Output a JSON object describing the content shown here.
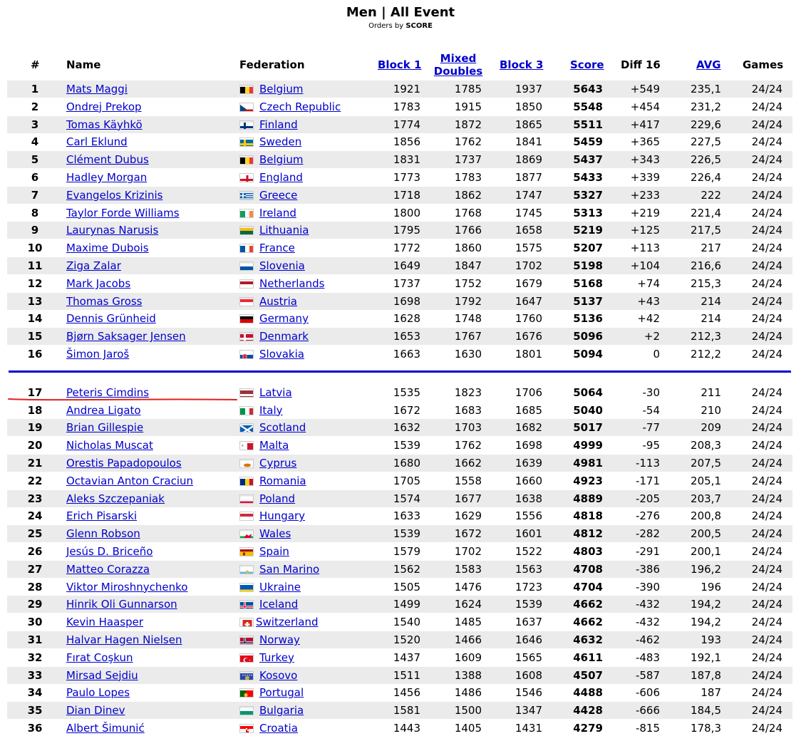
{
  "header": {
    "title": "Men | All Event",
    "subtitle_prefix": "Orders by",
    "subtitle_key": "SCORE"
  },
  "columns": {
    "rank": "#",
    "name": "Name",
    "federation": "Federation",
    "block1": "Block 1",
    "mixed1": "Mixed",
    "mixed2": "Doubles",
    "block3": "Block 3",
    "score": "Score",
    "diff": "Diff 16",
    "avg": "AVG",
    "games": "Games"
  },
  "colors": {
    "link": "#0000cc",
    "separator": "#0000cc",
    "highlight_underline": "#e0201e",
    "row_alt": "#ebebeb"
  },
  "rows": [
    {
      "rank": "1",
      "name": "Mats Maggi",
      "federation": "Belgium",
      "flag": "be",
      "block1": "1921",
      "mixed": "1785",
      "block3": "1937",
      "score": "5643",
      "diff": "+549",
      "avg": "235,1",
      "games": "24/24"
    },
    {
      "rank": "2",
      "name": "Ondrej Prekop",
      "federation": "Czech Republic",
      "flag": "cz",
      "block1": "1783",
      "mixed": "1915",
      "block3": "1850",
      "score": "5548",
      "diff": "+454",
      "avg": "231,2",
      "games": "24/24"
    },
    {
      "rank": "3",
      "name": "Tomas Käyhkö",
      "federation": "Finland",
      "flag": "fi",
      "block1": "1774",
      "mixed": "1872",
      "block3": "1865",
      "score": "5511",
      "diff": "+417",
      "avg": "229,6",
      "games": "24/24"
    },
    {
      "rank": "4",
      "name": "Carl Eklund",
      "federation": "Sweden",
      "flag": "se",
      "block1": "1856",
      "mixed": "1762",
      "block3": "1841",
      "score": "5459",
      "diff": "+365",
      "avg": "227,5",
      "games": "24/24"
    },
    {
      "rank": "5",
      "name": "Clément Dubus",
      "federation": "Belgium",
      "flag": "be",
      "block1": "1831",
      "mixed": "1737",
      "block3": "1869",
      "score": "5437",
      "diff": "+343",
      "avg": "226,5",
      "games": "24/24"
    },
    {
      "rank": "6",
      "name": "Hadley Morgan",
      "federation": "England",
      "flag": "en",
      "block1": "1773",
      "mixed": "1783",
      "block3": "1877",
      "score": "5433",
      "diff": "+339",
      "avg": "226,4",
      "games": "24/24"
    },
    {
      "rank": "7",
      "name": "Evangelos Krizinis",
      "federation": "Greece",
      "flag": "gr",
      "block1": "1718",
      "mixed": "1862",
      "block3": "1747",
      "score": "5327",
      "diff": "+233",
      "avg": "222",
      "games": "24/24"
    },
    {
      "rank": "8",
      "name": "Taylor Forde Williams",
      "federation": "Ireland",
      "flag": "ie",
      "block1": "1800",
      "mixed": "1768",
      "block3": "1745",
      "score": "5313",
      "diff": "+219",
      "avg": "221,4",
      "games": "24/24"
    },
    {
      "rank": "9",
      "name": "Laurynas Narusis",
      "federation": "Lithuania",
      "flag": "lt",
      "block1": "1795",
      "mixed": "1766",
      "block3": "1658",
      "score": "5219",
      "diff": "+125",
      "avg": "217,5",
      "games": "24/24"
    },
    {
      "rank": "10",
      "name": "Maxime Dubois",
      "federation": "France",
      "flag": "fr",
      "block1": "1772",
      "mixed": "1860",
      "block3": "1575",
      "score": "5207",
      "diff": "+113",
      "avg": "217",
      "games": "24/24"
    },
    {
      "rank": "11",
      "name": "Ziga Zalar",
      "federation": "Slovenia",
      "flag": "si",
      "block1": "1649",
      "mixed": "1847",
      "block3": "1702",
      "score": "5198",
      "diff": "+104",
      "avg": "216,6",
      "games": "24/24"
    },
    {
      "rank": "12",
      "name": "Mark Jacobs",
      "federation": "Netherlands",
      "flag": "nl",
      "block1": "1737",
      "mixed": "1752",
      "block3": "1679",
      "score": "5168",
      "diff": "+74",
      "avg": "215,3",
      "games": "24/24"
    },
    {
      "rank": "13",
      "name": "Thomas Gross",
      "federation": "Austria",
      "flag": "at",
      "block1": "1698",
      "mixed": "1792",
      "block3": "1647",
      "score": "5137",
      "diff": "+43",
      "avg": "214",
      "games": "24/24"
    },
    {
      "rank": "14",
      "name": "Dennis Grünheid",
      "federation": "Germany",
      "flag": "de",
      "block1": "1628",
      "mixed": "1748",
      "block3": "1760",
      "score": "5136",
      "diff": "+42",
      "avg": "214",
      "games": "24/24"
    },
    {
      "rank": "15",
      "name": "Bjørn Saksager Jensen",
      "federation": "Denmark",
      "flag": "dk",
      "block1": "1653",
      "mixed": "1767",
      "block3": "1676",
      "score": "5096",
      "diff": "+2",
      "avg": "212,3",
      "games": "24/24"
    },
    {
      "rank": "16",
      "name": "Šimon Jaroš",
      "federation": "Slovakia",
      "flag": "sk",
      "block1": "1663",
      "mixed": "1630",
      "block3": "1801",
      "score": "5094",
      "diff": "0",
      "avg": "212,2",
      "games": "24/24"
    },
    {
      "rank": "17",
      "name": "Peteris Cimdins",
      "federation": "Latvia",
      "flag": "lv",
      "block1": "1535",
      "mixed": "1823",
      "block3": "1706",
      "score": "5064",
      "diff": "-30",
      "avg": "211",
      "games": "24/24"
    },
    {
      "rank": "18",
      "name": "Andrea Ligato",
      "federation": "Italy",
      "flag": "it",
      "block1": "1672",
      "mixed": "1683",
      "block3": "1685",
      "score": "5040",
      "diff": "-54",
      "avg": "210",
      "games": "24/24"
    },
    {
      "rank": "19",
      "name": "Brian Gillespie",
      "federation": "Scotland",
      "flag": "sc",
      "block1": "1632",
      "mixed": "1703",
      "block3": "1682",
      "score": "5017",
      "diff": "-77",
      "avg": "209",
      "games": "24/24"
    },
    {
      "rank": "20",
      "name": "Nicholas Muscat",
      "federation": "Malta",
      "flag": "mt",
      "block1": "1539",
      "mixed": "1762",
      "block3": "1698",
      "score": "4999",
      "diff": "-95",
      "avg": "208,3",
      "games": "24/24"
    },
    {
      "rank": "21",
      "name": "Orestis Papadopoulos",
      "federation": "Cyprus",
      "flag": "cy",
      "block1": "1680",
      "mixed": "1662",
      "block3": "1639",
      "score": "4981",
      "diff": "-113",
      "avg": "207,5",
      "games": "24/24"
    },
    {
      "rank": "22",
      "name": "Octavian Anton Craciun",
      "federation": "Romania",
      "flag": "ro",
      "block1": "1705",
      "mixed": "1558",
      "block3": "1660",
      "score": "4923",
      "diff": "-171",
      "avg": "205,1",
      "games": "24/24"
    },
    {
      "rank": "23",
      "name": "Aleks Szczepaniak",
      "federation": "Poland",
      "flag": "pl",
      "block1": "1574",
      "mixed": "1677",
      "block3": "1638",
      "score": "4889",
      "diff": "-205",
      "avg": "203,7",
      "games": "24/24"
    },
    {
      "rank": "24",
      "name": "Erich Pisarski",
      "federation": "Hungary",
      "flag": "hu",
      "block1": "1633",
      "mixed": "1629",
      "block3": "1556",
      "score": "4818",
      "diff": "-276",
      "avg": "200,8",
      "games": "24/24"
    },
    {
      "rank": "25",
      "name": "Glenn Robson",
      "federation": "Wales",
      "flag": "wa",
      "block1": "1539",
      "mixed": "1672",
      "block3": "1601",
      "score": "4812",
      "diff": "-282",
      "avg": "200,5",
      "games": "24/24"
    },
    {
      "rank": "26",
      "name": "Jesús D. Briceño",
      "federation": "Spain",
      "flag": "es",
      "block1": "1579",
      "mixed": "1702",
      "block3": "1522",
      "score": "4803",
      "diff": "-291",
      "avg": "200,1",
      "games": "24/24"
    },
    {
      "rank": "27",
      "name": "Matteo Corazza",
      "federation": "San Marino",
      "flag": "sm",
      "block1": "1562",
      "mixed": "1583",
      "block3": "1563",
      "score": "4708",
      "diff": "-386",
      "avg": "196,2",
      "games": "24/24"
    },
    {
      "rank": "28",
      "name": "Viktor Miroshnychenko",
      "federation": "Ukraine",
      "flag": "ua",
      "block1": "1505",
      "mixed": "1476",
      "block3": "1723",
      "score": "4704",
      "diff": "-390",
      "avg": "196",
      "games": "24/24"
    },
    {
      "rank": "29",
      "name": "Hinrik Oli Gunnarson",
      "federation": "Iceland",
      "flag": "is",
      "block1": "1499",
      "mixed": "1624",
      "block3": "1539",
      "score": "4662",
      "diff": "-432",
      "avg": "194,2",
      "games": "24/24"
    },
    {
      "rank": "30",
      "name": "Kevin Haasper",
      "federation": "Switzerland",
      "flag": "ch",
      "block1": "1540",
      "mixed": "1485",
      "block3": "1637",
      "score": "4662",
      "diff": "-432",
      "avg": "194,2",
      "games": "24/24"
    },
    {
      "rank": "31",
      "name": "Halvar Hagen Nielsen",
      "federation": "Norway",
      "flag": "no",
      "block1": "1520",
      "mixed": "1466",
      "block3": "1646",
      "score": "4632",
      "diff": "-462",
      "avg": "193",
      "games": "24/24"
    },
    {
      "rank": "32",
      "name": "Fırat Coşkun",
      "federation": "Turkey",
      "flag": "tr",
      "block1": "1437",
      "mixed": "1609",
      "block3": "1565",
      "score": "4611",
      "diff": "-483",
      "avg": "192,1",
      "games": "24/24"
    },
    {
      "rank": "33",
      "name": "Mirsad Sejdiu",
      "federation": "Kosovo",
      "flag": "xk",
      "block1": "1511",
      "mixed": "1388",
      "block3": "1608",
      "score": "4507",
      "diff": "-587",
      "avg": "187,8",
      "games": "24/24"
    },
    {
      "rank": "34",
      "name": "Paulo Lopes",
      "federation": "Portugal",
      "flag": "pt",
      "block1": "1456",
      "mixed": "1486",
      "block3": "1546",
      "score": "4488",
      "diff": "-606",
      "avg": "187",
      "games": "24/24"
    },
    {
      "rank": "35",
      "name": "Dian Dinev",
      "federation": "Bulgaria",
      "flag": "bg",
      "block1": "1581",
      "mixed": "1500",
      "block3": "1347",
      "score": "4428",
      "diff": "-666",
      "avg": "184,5",
      "games": "24/24"
    },
    {
      "rank": "36",
      "name": "Albert Šimunić",
      "federation": "Croatia",
      "flag": "hr",
      "block1": "1443",
      "mixed": "1405",
      "block3": "1431",
      "score": "4279",
      "diff": "-815",
      "avg": "178,3",
      "games": "24/24"
    }
  ]
}
